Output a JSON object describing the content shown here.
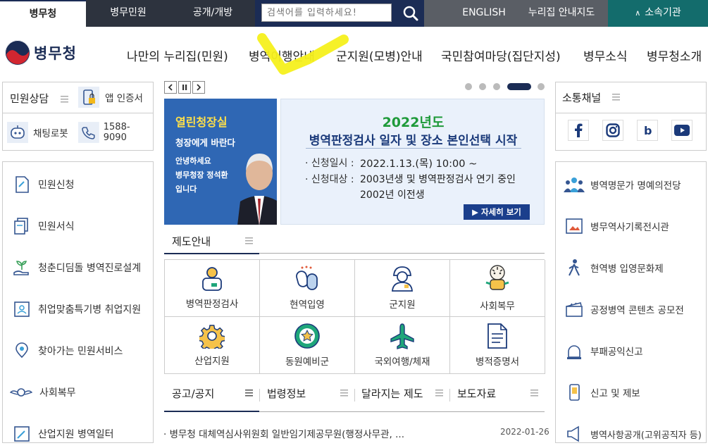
{
  "topbar": {
    "tabs": [
      "병무청",
      "병무민원",
      "공개/개방"
    ],
    "search_placeholder": "검색어를 입력하세요!",
    "english": "ENGLISH",
    "sitemap": "누리집 안내지도",
    "affiliates": "소속기관"
  },
  "header": {
    "logo": "병무청",
    "nav": [
      "나만의 누리집(민원)",
      "병역이행안내",
      "군지원(모병)안내",
      "국민참여마당(집단지성)",
      "병무소식",
      "병무청소개"
    ]
  },
  "left": {
    "consult_title": "민원상담",
    "app_cert": "앱 인증서",
    "chatbot": "채팅로봇",
    "phone": "1588-9090",
    "menu": [
      "민원신청",
      "민원서식",
      "청춘디딤돌 병역진로설계",
      "취업맞춤특기병 취업지원",
      "찾아가는 민원서비스",
      "사회복무",
      "산업지원 병역일터"
    ]
  },
  "banner": {
    "left_title": "열린청장실",
    "left_sub": "청장에게 바란다",
    "left_line1": "안녕하세요",
    "left_line2": "병무청장 정석환",
    "left_line3": "입니다",
    "year": "2022년도",
    "headline": "병역판정검사 일자 및 장소 본인선택 시작",
    "label1": "신청일시 :",
    "value1": "2022.1.13.(목) 10:00 ~",
    "label2": "신청대상 :",
    "value2a": "2003년생 및 병역판정검사 연기 중인",
    "value2b": "2002년 이전생",
    "more": "▶ 자세히 보기"
  },
  "system": {
    "title": "제도안내",
    "tiles": [
      "병역판정검사",
      "현역입영",
      "군지원",
      "사회복무",
      "산업지원",
      "동원예비군",
      "국외여행/체재",
      "병적증명서"
    ]
  },
  "notice": {
    "tabs": [
      "공고/공지",
      "법령정보",
      "달라지는 제도",
      "보도자료"
    ],
    "item_text": "병무청 대체역심사위원회 일반임기제공무원(행정사무관, ...",
    "item_date": "2022-01-26"
  },
  "right": {
    "sns_title": "소통채널",
    "menu": [
      "병역명문가 명예의전당",
      "병무역사기록전시관",
      "현역병 입영문화제",
      "공정병역 콘텐츠 공모전",
      "부패공익신고",
      "신고 및 제보",
      "병역사항공개(고위공직자 등)"
    ]
  }
}
